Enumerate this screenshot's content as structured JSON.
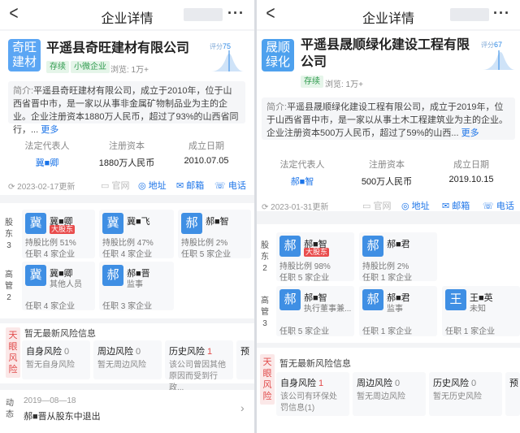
{
  "left": {
    "title": "企业详情",
    "company_name": "平遥县奇旺建材有限公司",
    "logo_text": [
      "奇旺",
      "建材"
    ],
    "tags": [
      "存续",
      "小微企业"
    ],
    "views": "浏览: 1万+",
    "score": {
      "label": "评分",
      "value": "75"
    },
    "intro": {
      "label": "简介:",
      "text": "平遥县奇旺建材有限公司，成立于2010年，位于山西省晋中市，是一家以从事非金属矿物制品业为主的企业。企业注册资本1880万人民币，超过了93%的山西省同行，...",
      "more": "更多"
    },
    "facts": [
      {
        "k": "法定代表人",
        "v": "冀■卿"
      },
      {
        "k": "注册资本",
        "v": "1880万人民币"
      },
      {
        "k": "成立日期",
        "v": "2010.07.05"
      }
    ],
    "updated": "2023-02-17更新",
    "actions": [
      "官网",
      "地址",
      "邮箱",
      "电话"
    ],
    "shareholders_label": "股东",
    "shareholders_count": "3",
    "shareholders": [
      {
        "avatar": "冀",
        "name": "冀■卿",
        "badge": "大股东",
        "line1": "持股比例 51%",
        "line2": "任职 4 家企业"
      },
      {
        "avatar": "冀",
        "name": "冀■飞",
        "line1": "持股比例 47%",
        "line2": "任职 4 家企业"
      },
      {
        "avatar": "郝",
        "name": "郝■智",
        "line1": "持股比例 2%",
        "line2": "任职 5 家企业"
      }
    ],
    "managers_label": "高管",
    "managers_count": "2",
    "managers": [
      {
        "avatar": "冀",
        "name": "冀■卿",
        "role": "其他人员",
        "line2": "任职 4 家企业"
      },
      {
        "avatar": "郝",
        "name": "郝■晋",
        "role": "监事",
        "line2": "任职 3 家企业"
      }
    ],
    "risk_label": "天眼风险",
    "risk_note": "暂无最新风险信息",
    "risks": [
      {
        "t": "自身风险",
        "n": "0",
        "d": "暂无自身风险"
      },
      {
        "t": "周边风险",
        "n": "0",
        "d": "暂无周边风险"
      },
      {
        "t": "历史风险",
        "n": "1",
        "d": "该公司曾因其他原因而受到行政..."
      },
      {
        "t": "预",
        "n": "",
        "d": ""
      }
    ],
    "dynamic_label": "动态",
    "dynamic_date": "2019—08—18",
    "dynamic_text": "郝■晋从股东中退出"
  },
  "right": {
    "title": "企业详情",
    "company_name": "平遥县晟顺绿化建设工程有限公司",
    "logo_text": [
      "晟顺",
      "绿化"
    ],
    "tags": [
      "存续"
    ],
    "views": "浏览: 1万+",
    "score": {
      "label": "评分",
      "value": "67"
    },
    "intro": {
      "label": "简介:",
      "text": "平遥县晟顺绿化建设工程有限公司，成立于2019年，位于山西省晋中市，是一家以从事土木工程建筑业为主的企业。企业注册资本500万人民币，超过了59%的山西...",
      "more": "更多"
    },
    "facts": [
      {
        "k": "法定代表人",
        "v": "郝■智"
      },
      {
        "k": "注册资本",
        "v": "500万人民币"
      },
      {
        "k": "成立日期",
        "v": "2019.10.15"
      }
    ],
    "updated": "2023-01-31更新",
    "actions": [
      "官网",
      "地址",
      "邮箱",
      "电话"
    ],
    "shareholders_label": "股东",
    "shareholders_count": "2",
    "shareholders": [
      {
        "avatar": "郝",
        "name": "郝■智",
        "badge": "大股东",
        "line1": "持股比例 98%",
        "line2": "任职 5 家企业"
      },
      {
        "avatar": "郝",
        "name": "郝■君",
        "line1": "持股比例 2%",
        "line2": "任职 1 家企业"
      }
    ],
    "managers_label": "高管",
    "managers_count": "3",
    "managers": [
      {
        "avatar": "郝",
        "name": "郝■智",
        "role": "执行董事兼...",
        "line2": "任职 5 家企业"
      },
      {
        "avatar": "郝",
        "name": "郝■君",
        "role": "监事",
        "line2": "任职 1 家企业"
      },
      {
        "avatar": "王",
        "name": "王■英",
        "role": "未知",
        "line2": "任职 1 家企业"
      }
    ],
    "risk_label": "天眼风险",
    "risk_note": "暂无最新风险信息",
    "risks": [
      {
        "t": "自身风险",
        "n": "1",
        "d": "该公司有环保处罚信息(1)"
      },
      {
        "t": "周边风险",
        "n": "0",
        "d": "暂无周边风险"
      },
      {
        "t": "历史风险",
        "n": "0",
        "d": "暂无历史风险"
      },
      {
        "t": "预",
        "n": "",
        "d": ""
      }
    ]
  }
}
